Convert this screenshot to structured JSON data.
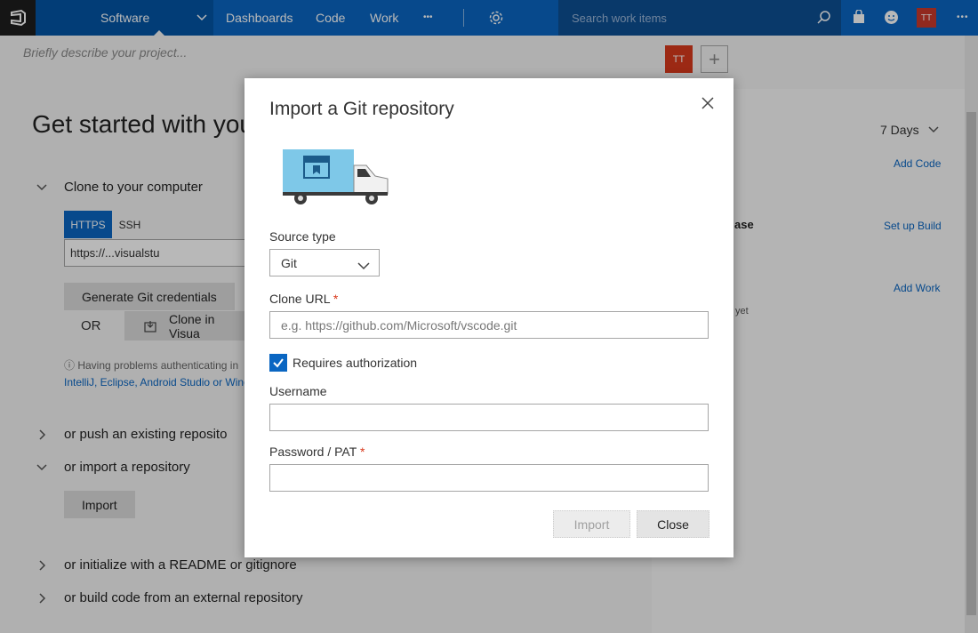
{
  "topbar": {
    "project_name": "Software",
    "nav": [
      "Dashboards",
      "Code",
      "Work"
    ],
    "more": "•••",
    "search_placeholder": "Search work items",
    "avatar_initials": "TT"
  },
  "page": {
    "description_placeholder": "Briefly describe your project...",
    "heading": "Get started with you",
    "avatar_initials": "TT",
    "sections": {
      "clone": "Clone to your computer",
      "push": "or push an existing reposito",
      "import": "or import a repository",
      "readme": "or initialize with a README or gitignore",
      "build": "or build code from an external repository"
    },
    "tabs": {
      "https": "HTTPS",
      "ssh": "SSH"
    },
    "clone_url_value": "https://...visualstu",
    "generate_credentials": "Generate Git credentials",
    "or_label": "OR",
    "clone_in_visual": "Clone in Visua",
    "help_text": "Having problems authenticating in",
    "help_links": "IntelliJ, Eclipse, Android Studio or Wind",
    "import_button": "Import",
    "right": {
      "days": "7 Days",
      "add_code": "Add Code",
      "release_fragment": "ase",
      "set_up_build": "Set up Build",
      "add_work": "Add Work",
      "yet_fragment": "yet"
    }
  },
  "dialog": {
    "title": "Import a Git repository",
    "source_type_label": "Source type",
    "source_type_value": "Git",
    "clone_url_label": "Clone URL",
    "clone_url_placeholder": "e.g. https://github.com/Microsoft/vscode.git",
    "requires_auth_label": "Requires authorization",
    "requires_auth_checked": true,
    "username_label": "Username",
    "username_value": "",
    "password_label": "Password / PAT",
    "password_value": "",
    "required_mark": "*",
    "import_button": "Import",
    "close_button": "Close"
  },
  "colors": {
    "accent": "#0a66c2",
    "topbar": "#0a66c2",
    "project_bg": "#0355a6",
    "avatar": "#d9391c",
    "required": "#d9391c"
  }
}
